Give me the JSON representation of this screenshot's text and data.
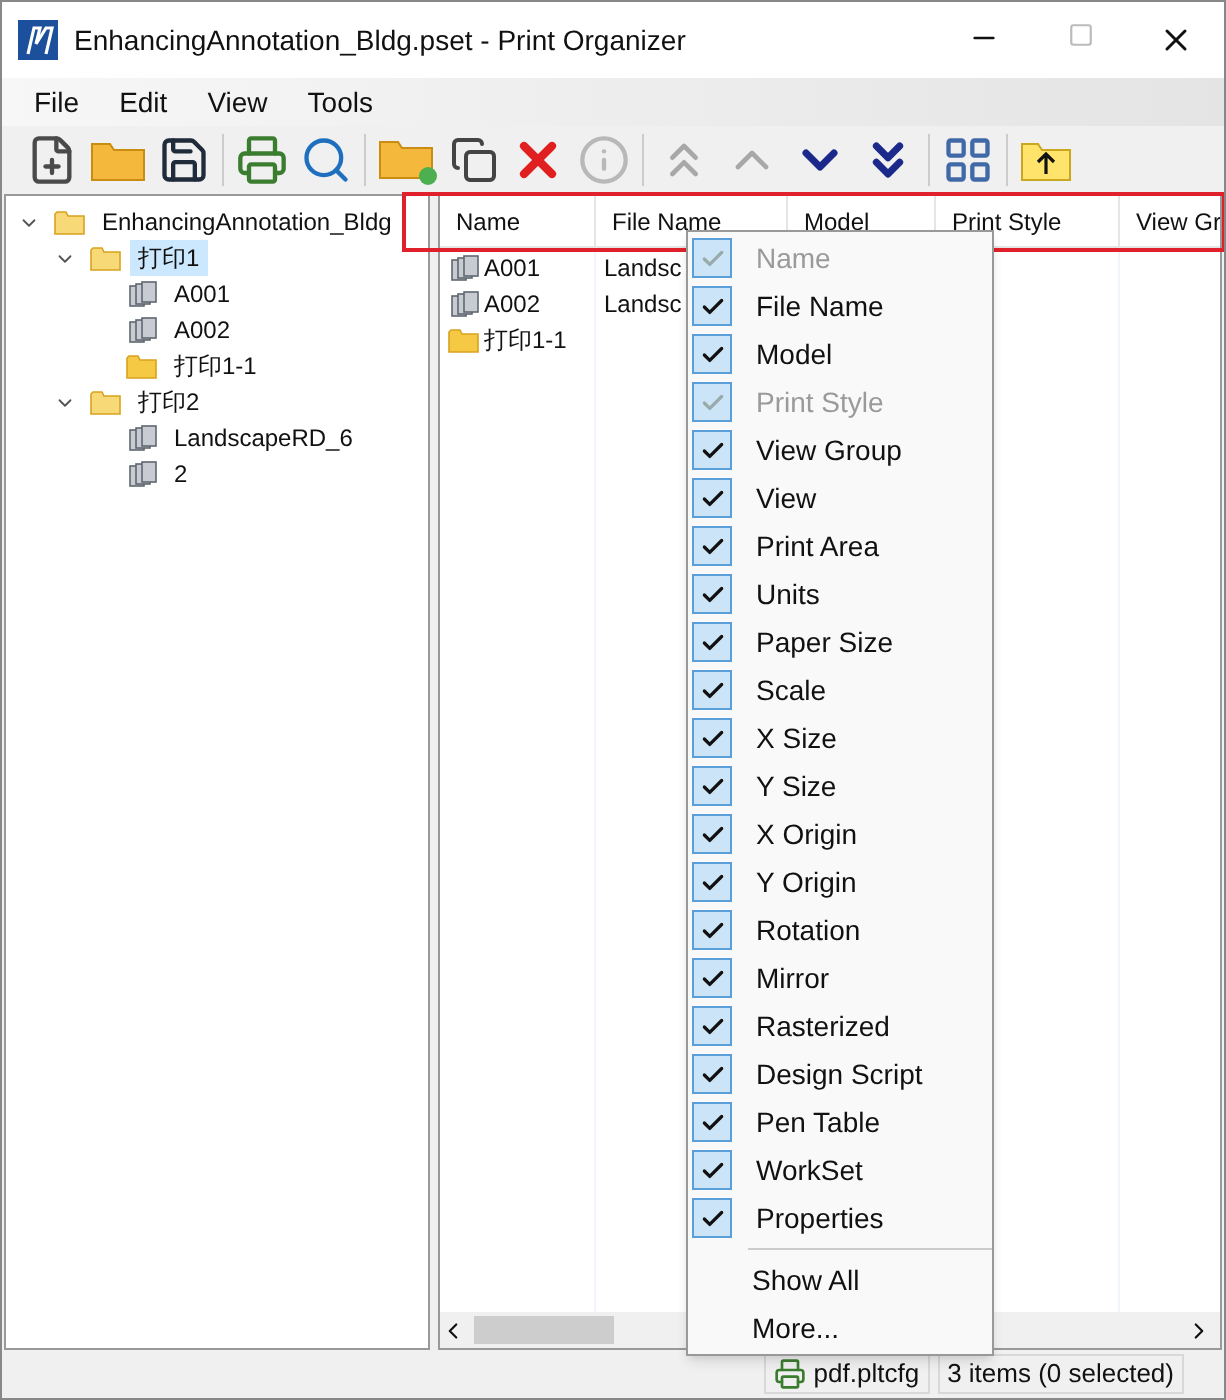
{
  "window": {
    "title": "EnhancingAnnotation_Bldg.pset - Print Organizer"
  },
  "menu_bar": [
    "File",
    "Edit",
    "View",
    "Tools"
  ],
  "tree": [
    {
      "label": "EnhancingAnnotation_Bldg",
      "kind": "folder",
      "expanded": true,
      "selected": false,
      "children": [
        {
          "label": "打印1",
          "kind": "folder",
          "expanded": true,
          "selected": true,
          "children": [
            {
              "label": "A001",
              "kind": "sheet",
              "selected": false
            },
            {
              "label": "A002",
              "kind": "sheet",
              "selected": false
            },
            {
              "label": "打印1-1",
              "kind": "folder",
              "selected": false
            }
          ]
        },
        {
          "label": "打印2",
          "kind": "folder",
          "expanded": true,
          "selected": false,
          "children": [
            {
              "label": "LandscapeRD_6",
              "kind": "sheet",
              "selected": false
            },
            {
              "label": "2",
              "kind": "sheet",
              "selected": false
            }
          ]
        }
      ]
    }
  ],
  "table": {
    "columns": [
      "Name",
      "File Name",
      "Model",
      "Print Style",
      "View Gr"
    ],
    "rows": [
      {
        "kind": "sheet",
        "name": "A001",
        "file_name": "Landsc"
      },
      {
        "kind": "sheet",
        "name": "A002",
        "file_name": "Landsc"
      },
      {
        "kind": "folder",
        "name": "打印1-1"
      }
    ]
  },
  "context_menu": {
    "items": [
      {
        "label": "Name",
        "checked": true,
        "disabled": true
      },
      {
        "label": "File Name",
        "checked": true,
        "disabled": false
      },
      {
        "label": "Model",
        "checked": true,
        "disabled": false
      },
      {
        "label": "Print Style",
        "checked": true,
        "disabled": true
      },
      {
        "label": "View Group",
        "checked": true,
        "disabled": false
      },
      {
        "label": "View",
        "checked": true,
        "disabled": false
      },
      {
        "label": "Print Area",
        "checked": true,
        "disabled": false
      },
      {
        "label": "Units",
        "checked": true,
        "disabled": false
      },
      {
        "label": "Paper Size",
        "checked": true,
        "disabled": false
      },
      {
        "label": "Scale",
        "checked": true,
        "disabled": false
      },
      {
        "label": "X Size",
        "checked": true,
        "disabled": false
      },
      {
        "label": "Y Size",
        "checked": true,
        "disabled": false
      },
      {
        "label": "X Origin",
        "checked": true,
        "disabled": false
      },
      {
        "label": "Y Origin",
        "checked": true,
        "disabled": false
      },
      {
        "label": "Rotation",
        "checked": true,
        "disabled": false
      },
      {
        "label": "Mirror",
        "checked": true,
        "disabled": false
      },
      {
        "label": "Rasterized",
        "checked": true,
        "disabled": false
      },
      {
        "label": "Design Script",
        "checked": true,
        "disabled": false
      },
      {
        "label": "Pen Table",
        "checked": true,
        "disabled": false
      },
      {
        "label": "WorkSet",
        "checked": true,
        "disabled": false
      },
      {
        "label": "Properties",
        "checked": true,
        "disabled": false
      }
    ],
    "actions": [
      "Show All",
      "More..."
    ]
  },
  "status_bar": {
    "printer": "pdf.pltcfg",
    "count": "3 items (0 selected)"
  }
}
